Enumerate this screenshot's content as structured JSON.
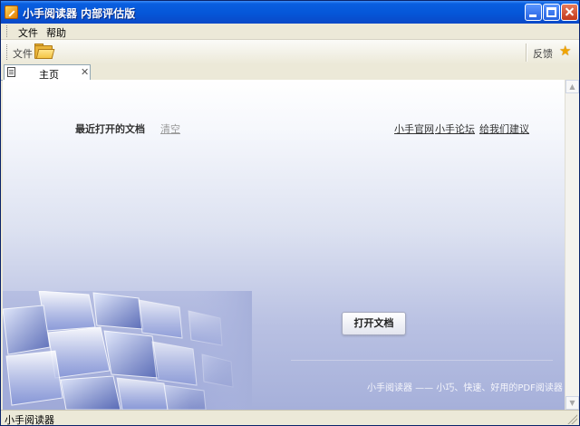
{
  "window": {
    "title": "小手阅读器  内部评估版",
    "icon": "app-pen-icon"
  },
  "menubar": {
    "items": [
      {
        "label": "文件"
      },
      {
        "label": "帮助"
      }
    ]
  },
  "toolbar": {
    "file_label": "文件",
    "feedback_label": "反馈",
    "open_icon": "folder-open-icon",
    "feedback_icon": "star-icon"
  },
  "tabs": [
    {
      "label": "主页",
      "active": true
    }
  ],
  "home": {
    "recent_label": "最近打开的文档",
    "clear_label": "清空",
    "links": [
      {
        "label": "小手官网"
      },
      {
        "label": "小手论坛"
      },
      {
        "label": "给我们建议"
      }
    ],
    "open_button": "打开文档",
    "tagline": "小手阅读器 —— 小巧、快速、好用的PDF阅读器"
  },
  "statusbar": {
    "text": "小手阅读器"
  },
  "colors": {
    "titlebar": "#0556d8",
    "close_button": "#c2391b",
    "content_bottom": "#a6b0da"
  }
}
